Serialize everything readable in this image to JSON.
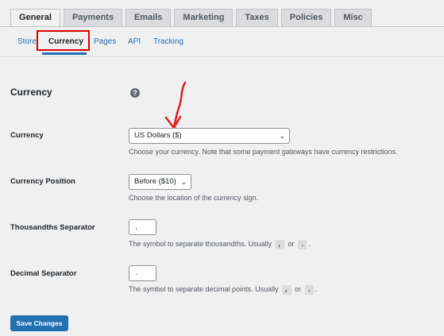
{
  "tabs": [
    {
      "label": "General",
      "active": true
    },
    {
      "label": "Payments"
    },
    {
      "label": "Emails"
    },
    {
      "label": "Marketing"
    },
    {
      "label": "Taxes"
    },
    {
      "label": "Policies"
    },
    {
      "label": "Misc"
    }
  ],
  "subnav": [
    {
      "label": "Store"
    },
    {
      "label": "Currency",
      "current": true
    },
    {
      "label": "Pages"
    },
    {
      "label": "API"
    },
    {
      "label": "Tracking"
    }
  ],
  "section": {
    "title": "Currency",
    "help_icon": "question-circle-icon"
  },
  "fields": {
    "currency": {
      "label": "Currency",
      "value": "US Dollars ($)",
      "description": "Choose your currency. Note that some payment gateways have currency restrictions."
    },
    "currency_position": {
      "label": "Currency Position",
      "value": "Before ($10)",
      "description": "Choose the location of the currency sign."
    },
    "thousands_separator": {
      "label": "Thousandths Separator",
      "value": ",",
      "description_prefix": "The symbol to separate thousandths. Usually",
      "code1": ",",
      "or_word": "or",
      "code2": ".",
      "description_suffix": "."
    },
    "decimal_separator": {
      "label": "Decimal Separator",
      "value": ".",
      "description_prefix": "The symbol to separate decimal points. Usually",
      "code1": ",",
      "or_word": "or",
      "code2": ".",
      "description_suffix": "."
    }
  },
  "save_button": "Save Changes",
  "colors": {
    "accent": "#2271b1",
    "highlight": "#e00000",
    "annotation_arrow": "#e02020"
  }
}
